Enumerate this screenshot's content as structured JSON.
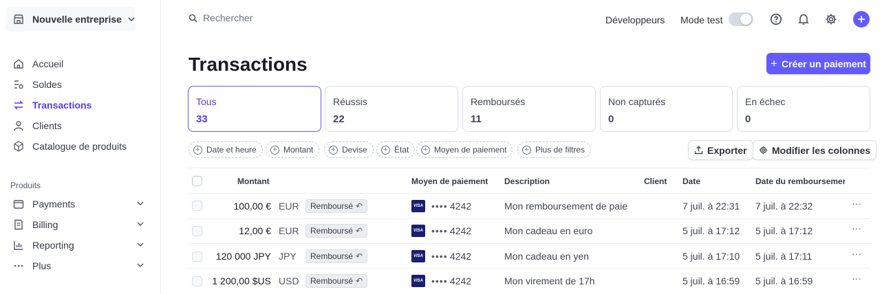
{
  "account": {
    "name": "Nouvelle entreprise"
  },
  "sidebar": {
    "items": [
      {
        "label": "Accueil",
        "icon": "home-icon"
      },
      {
        "label": "Soldes",
        "icon": "balances-icon"
      },
      {
        "label": "Transactions",
        "icon": "transactions-icon",
        "active": true
      },
      {
        "label": "Clients",
        "icon": "person-icon"
      },
      {
        "label": "Catalogue de produits",
        "icon": "box-icon"
      }
    ],
    "section_label": "Produits",
    "products": [
      {
        "label": "Payments",
        "icon": "wallet-icon"
      },
      {
        "label": "Billing",
        "icon": "invoice-icon"
      },
      {
        "label": "Reporting",
        "icon": "chart-icon"
      },
      {
        "label": "Plus",
        "icon": "more-icon"
      }
    ]
  },
  "topbar": {
    "search_placeholder": "Rechercher",
    "developers": "Développeurs",
    "test_mode": "Mode test"
  },
  "page": {
    "title": "Transactions",
    "create_button": "Créer un paiement"
  },
  "filters": [
    {
      "label": "Tous",
      "count": "33",
      "active": true
    },
    {
      "label": "Réussis",
      "count": "22"
    },
    {
      "label": "Remboursés",
      "count": "11"
    },
    {
      "label": "Non capturés",
      "count": "0"
    },
    {
      "label": "En échec",
      "count": "0"
    }
  ],
  "chips": [
    "Date et heure",
    "Montant",
    "Devise",
    "État",
    "Moyen de paiement",
    "Plus de filtres"
  ],
  "actions": {
    "export": "Exporter",
    "edit_columns": "Modifier les colonnes"
  },
  "table": {
    "headers": {
      "amount": "Montant",
      "payment_method": "Moyen de paiement",
      "description": "Description",
      "client": "Client",
      "date": "Date",
      "refund_date": "Date du remboursemer"
    },
    "rows": [
      {
        "amount": "100,00 €",
        "currency": "EUR",
        "status": "Remboursé",
        "card_brand": "VISA",
        "card_dots": "••••",
        "card_last4": "4242",
        "description": "Mon remboursement de paie",
        "date": "7 juil. à 22:31",
        "refund_date": "7 juil. à 22:32"
      },
      {
        "amount": "12,00 €",
        "currency": "EUR",
        "status": "Remboursé",
        "card_brand": "VISA",
        "card_dots": "••••",
        "card_last4": "4242",
        "description": "Mon cadeau en euro",
        "date": "5 juil. à 17:12",
        "refund_date": "5 juil. à 17:12"
      },
      {
        "amount": "120 000 JPY",
        "currency": "JPY",
        "status": "Remboursé",
        "card_brand": "VISA",
        "card_dots": "••••",
        "card_last4": "4242",
        "description": "Mon cadeau en yen",
        "date": "5 juil. à 17:10",
        "refund_date": "5 juil. à 17:11"
      },
      {
        "amount": "1 200,00 $US",
        "currency": "USD",
        "status": "Remboursé",
        "card_brand": "VISA",
        "card_dots": "••••",
        "card_last4": "4242",
        "description": "Mon virement de 17h",
        "date": "5 juil. à 16:59",
        "refund_date": "5 juil. à 16:59"
      }
    ]
  },
  "colors": {
    "accent": "#635bff",
    "active_text": "#533afd",
    "visa": "#1a1f71"
  }
}
